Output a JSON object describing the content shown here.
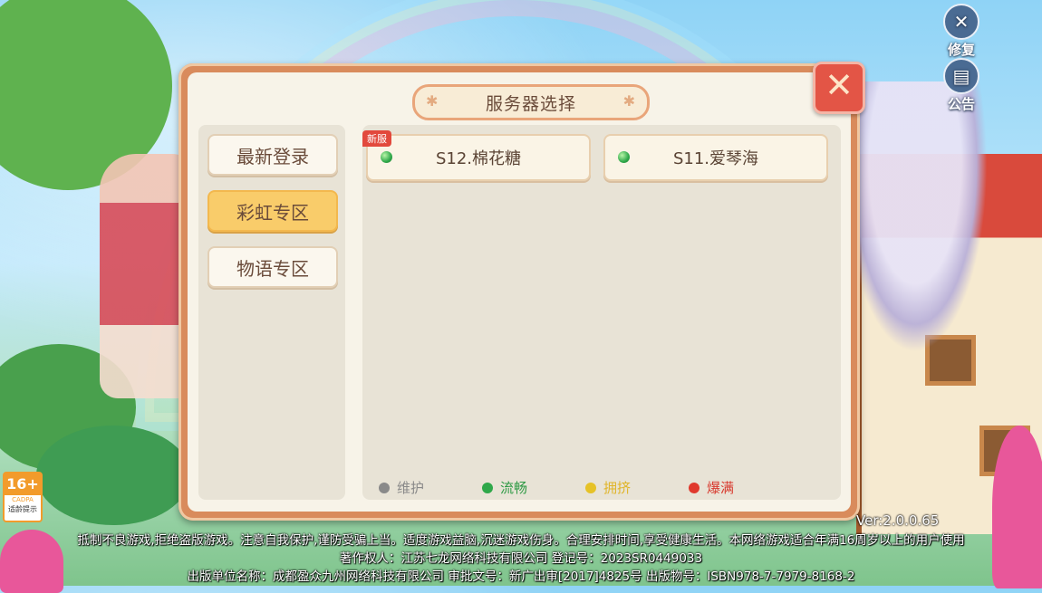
{
  "top_buttons": {
    "repair_label": "修复",
    "notice_label": "公告"
  },
  "dialog": {
    "title": "服务器选择",
    "close_icon": "close-x-icon"
  },
  "tabs": [
    {
      "label": "最新登录",
      "active": false
    },
    {
      "label": "彩虹专区",
      "active": true
    },
    {
      "label": "物语专区",
      "active": false
    }
  ],
  "servers": [
    {
      "name": "S12.棉花糖",
      "status": "流畅",
      "tag": "新服"
    },
    {
      "name": "S11.爱琴海",
      "status": "流畅",
      "tag": ""
    }
  ],
  "legend": [
    {
      "label": "维护",
      "color": "#8a8a8a",
      "text_color": "#8a8a8a"
    },
    {
      "label": "流畅",
      "color": "#2fa84a",
      "text_color": "#2f9a45"
    },
    {
      "label": "拥挤",
      "color": "#e6c227",
      "text_color": "#e0b52a"
    },
    {
      "label": "爆满",
      "color": "#e0392d",
      "text_color": "#d83a2e"
    }
  ],
  "version": "Ver:2.0.0.65",
  "age_rating": {
    "number": "16+",
    "org": "CADPA",
    "tip": "适龄提示"
  },
  "footer": {
    "line1": "抵制不良游戏,拒绝盗版游戏。注意自我保护,谨防受骗上当。适度游戏益脑,沉迷游戏伤身。合理安排时间,享受健康生活。本网络游戏适合年满16周岁以上的用户使用",
    "line2": "著作权人：江苏七龙网络科技有限公司   登记号：2023SR0449033",
    "line3": "出版单位名称：成都盈众九州网络科技有限公司   审批文号：新广出审[2017]4825号   出版物号：ISBN978-7-7979-8168-2"
  }
}
